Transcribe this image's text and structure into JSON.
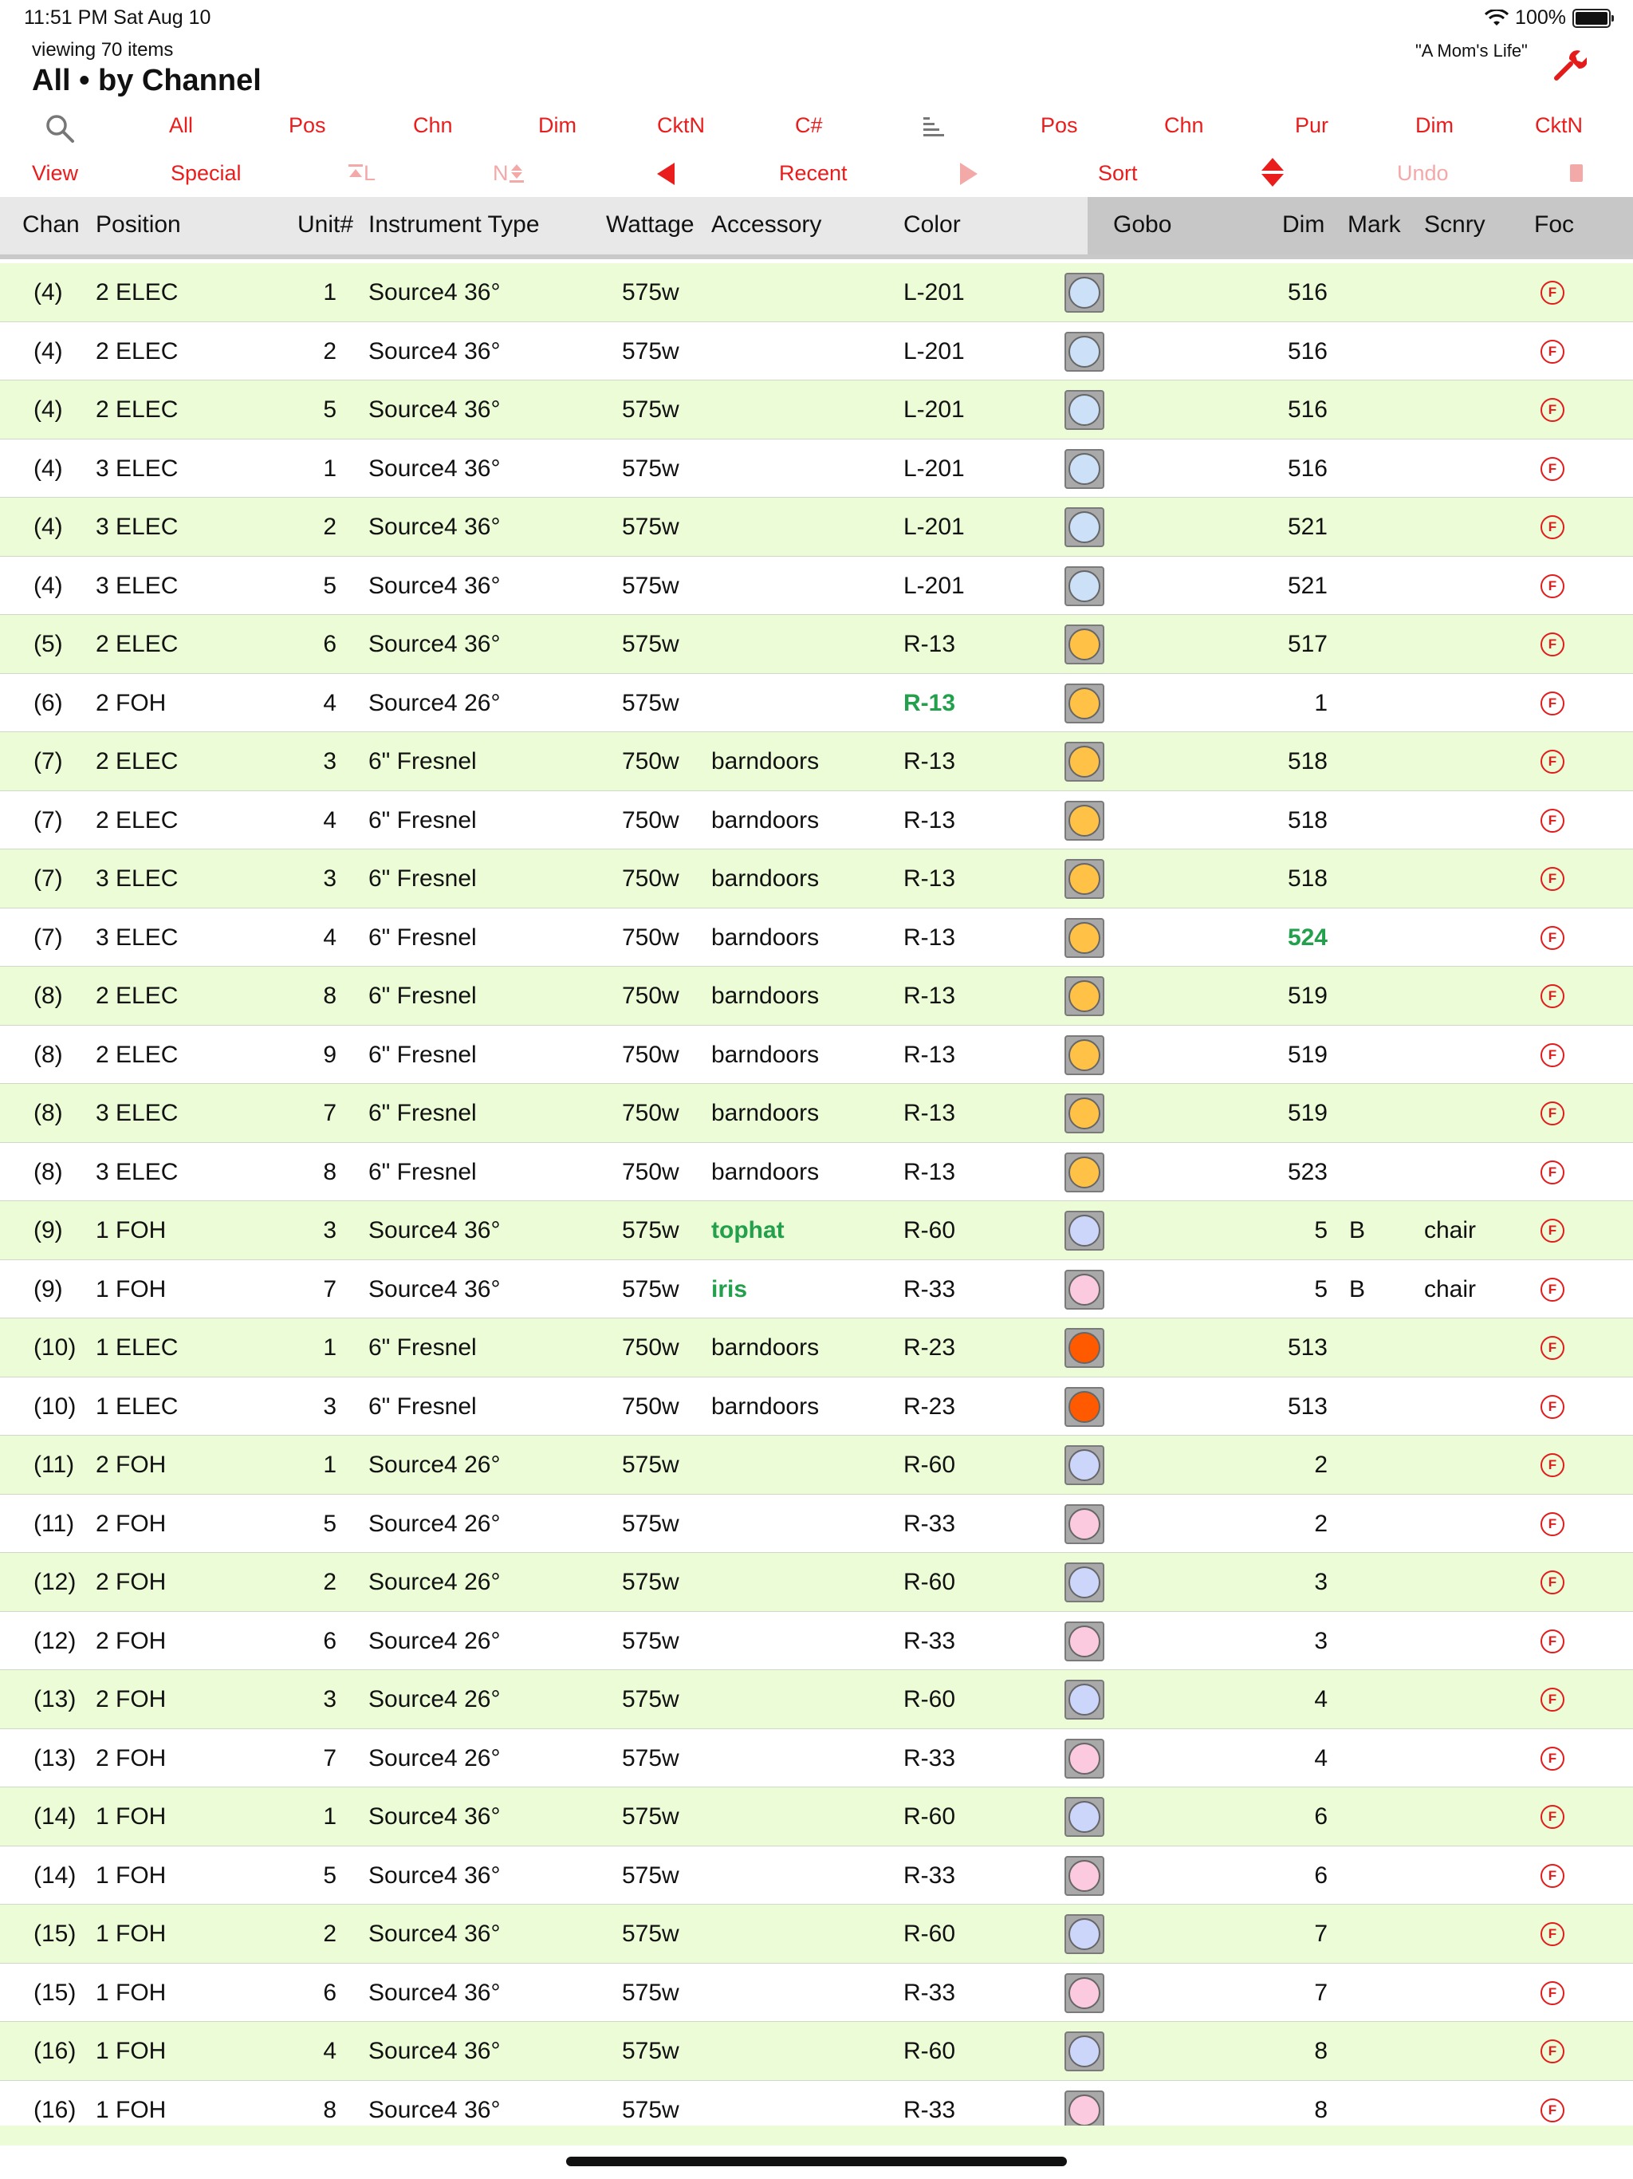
{
  "status": {
    "time": "11:51 PM   Sat Aug 10",
    "battery": "100%"
  },
  "header": {
    "viewing": "viewing 70 items",
    "title": "All • by Channel",
    "show_name": "\"A Mom's Life\""
  },
  "toolbar1": {
    "all": "All",
    "pos": "Pos",
    "chn": "Chn",
    "dim": "Dim",
    "cktn": "CktN",
    "cnum": "C#",
    "pos2": "Pos",
    "chn2": "Chn",
    "pur": "Pur",
    "dim2": "Dim",
    "cktn2": "CktN"
  },
  "toolbar2": {
    "view": "View",
    "special": "Special",
    "label_l": "L",
    "label_n": "N",
    "recent": "Recent",
    "sort": "Sort",
    "undo": "Undo"
  },
  "columns": {
    "chan": "Chan",
    "position": "Position",
    "unit": "Unit#",
    "itype": "Instrument Type",
    "wattage": "Wattage",
    "accessory": "Accessory",
    "color": "Color",
    "gobo": "Gobo",
    "dim": "Dim",
    "mark": "Mark",
    "scnry": "Scnry",
    "foc": "Foc"
  },
  "focus_glyph": "F",
  "swatch_colors": {
    "L-201": "#cce0f7",
    "R-13": "#ffc247",
    "R-60": "#ccd6fa",
    "R-33": "#fbcade",
    "R-23": "#ff5a00"
  },
  "rows": [
    {
      "chan": "(4)",
      "pos": "2 ELEC",
      "unit": "1",
      "itype": "Source4 36°",
      "watt": "575w",
      "acc": "",
      "color": "L-201",
      "dim": "516",
      "mark": "",
      "scnry": ""
    },
    {
      "chan": "(4)",
      "pos": "2 ELEC",
      "unit": "2",
      "itype": "Source4 36°",
      "watt": "575w",
      "acc": "",
      "color": "L-201",
      "dim": "516",
      "mark": "",
      "scnry": ""
    },
    {
      "chan": "(4)",
      "pos": "2 ELEC",
      "unit": "5",
      "itype": "Source4 36°",
      "watt": "575w",
      "acc": "",
      "color": "L-201",
      "dim": "516",
      "mark": "",
      "scnry": ""
    },
    {
      "chan": "(4)",
      "pos": "3 ELEC",
      "unit": "1",
      "itype": "Source4 36°",
      "watt": "575w",
      "acc": "",
      "color": "L-201",
      "dim": "516",
      "mark": "",
      "scnry": ""
    },
    {
      "chan": "(4)",
      "pos": "3 ELEC",
      "unit": "2",
      "itype": "Source4 36°",
      "watt": "575w",
      "acc": "",
      "color": "L-201",
      "dim": "521",
      "mark": "",
      "scnry": ""
    },
    {
      "chan": "(4)",
      "pos": "3 ELEC",
      "unit": "5",
      "itype": "Source4 36°",
      "watt": "575w",
      "acc": "",
      "color": "L-201",
      "dim": "521",
      "mark": "",
      "scnry": ""
    },
    {
      "chan": "(5)",
      "pos": "2 ELEC",
      "unit": "6",
      "itype": "Source4 36°",
      "watt": "575w",
      "acc": "",
      "color": "R-13",
      "dim": "517",
      "mark": "",
      "scnry": ""
    },
    {
      "chan": "(6)",
      "pos": "2 FOH",
      "unit": "4",
      "itype": "Source4 26°",
      "watt": "575w",
      "acc": "",
      "color": "R-13",
      "dim": "1",
      "mark": "",
      "scnry": "",
      "hl_color": true
    },
    {
      "chan": "(7)",
      "pos": "2 ELEC",
      "unit": "3",
      "itype": "6\" Fresnel",
      "watt": "750w",
      "acc": "barndoors",
      "color": "R-13",
      "dim": "518",
      "mark": "",
      "scnry": ""
    },
    {
      "chan": "(7)",
      "pos": "2 ELEC",
      "unit": "4",
      "itype": "6\" Fresnel",
      "watt": "750w",
      "acc": "barndoors",
      "color": "R-13",
      "dim": "518",
      "mark": "",
      "scnry": ""
    },
    {
      "chan": "(7)",
      "pos": "3 ELEC",
      "unit": "3",
      "itype": "6\" Fresnel",
      "watt": "750w",
      "acc": "barndoors",
      "color": "R-13",
      "dim": "518",
      "mark": "",
      "scnry": ""
    },
    {
      "chan": "(7)",
      "pos": "3 ELEC",
      "unit": "4",
      "itype": "6\" Fresnel",
      "watt": "750w",
      "acc": "barndoors",
      "color": "R-13",
      "dim": "524",
      "mark": "",
      "scnry": "",
      "hl_dim": true
    },
    {
      "chan": "(8)",
      "pos": "2 ELEC",
      "unit": "8",
      "itype": "6\" Fresnel",
      "watt": "750w",
      "acc": "barndoors",
      "color": "R-13",
      "dim": "519",
      "mark": "",
      "scnry": ""
    },
    {
      "chan": "(8)",
      "pos": "2 ELEC",
      "unit": "9",
      "itype": "6\" Fresnel",
      "watt": "750w",
      "acc": "barndoors",
      "color": "R-13",
      "dim": "519",
      "mark": "",
      "scnry": ""
    },
    {
      "chan": "(8)",
      "pos": "3 ELEC",
      "unit": "7",
      "itype": "6\" Fresnel",
      "watt": "750w",
      "acc": "barndoors",
      "color": "R-13",
      "dim": "519",
      "mark": "",
      "scnry": ""
    },
    {
      "chan": "(8)",
      "pos": "3 ELEC",
      "unit": "8",
      "itype": "6\" Fresnel",
      "watt": "750w",
      "acc": "barndoors",
      "color": "R-13",
      "dim": "523",
      "mark": "",
      "scnry": ""
    },
    {
      "chan": "(9)",
      "pos": "1 FOH",
      "unit": "3",
      "itype": "Source4 36°",
      "watt": "575w",
      "acc": "tophat",
      "color": "R-60",
      "dim": "5",
      "mark": "B",
      "scnry": "chair",
      "hl_acc": true
    },
    {
      "chan": "(9)",
      "pos": "1 FOH",
      "unit": "7",
      "itype": "Source4 36°",
      "watt": "575w",
      "acc": "iris",
      "color": "R-33",
      "dim": "5",
      "mark": "B",
      "scnry": "chair",
      "hl_acc": true
    },
    {
      "chan": "(10)",
      "pos": "1 ELEC",
      "unit": "1",
      "itype": "6\" Fresnel",
      "watt": "750w",
      "acc": "barndoors",
      "color": "R-23",
      "dim": "513",
      "mark": "",
      "scnry": ""
    },
    {
      "chan": "(10)",
      "pos": "1 ELEC",
      "unit": "3",
      "itype": "6\" Fresnel",
      "watt": "750w",
      "acc": "barndoors",
      "color": "R-23",
      "dim": "513",
      "mark": "",
      "scnry": ""
    },
    {
      "chan": "(11)",
      "pos": "2 FOH",
      "unit": "1",
      "itype": "Source4 26°",
      "watt": "575w",
      "acc": "",
      "color": "R-60",
      "dim": "2",
      "mark": "",
      "scnry": ""
    },
    {
      "chan": "(11)",
      "pos": "2 FOH",
      "unit": "5",
      "itype": "Source4 26°",
      "watt": "575w",
      "acc": "",
      "color": "R-33",
      "dim": "2",
      "mark": "",
      "scnry": ""
    },
    {
      "chan": "(12)",
      "pos": "2 FOH",
      "unit": "2",
      "itype": "Source4 26°",
      "watt": "575w",
      "acc": "",
      "color": "R-60",
      "dim": "3",
      "mark": "",
      "scnry": ""
    },
    {
      "chan": "(12)",
      "pos": "2 FOH",
      "unit": "6",
      "itype": "Source4 26°",
      "watt": "575w",
      "acc": "",
      "color": "R-33",
      "dim": "3",
      "mark": "",
      "scnry": ""
    },
    {
      "chan": "(13)",
      "pos": "2 FOH",
      "unit": "3",
      "itype": "Source4 26°",
      "watt": "575w",
      "acc": "",
      "color": "R-60",
      "dim": "4",
      "mark": "",
      "scnry": ""
    },
    {
      "chan": "(13)",
      "pos": "2 FOH",
      "unit": "7",
      "itype": "Source4 26°",
      "watt": "575w",
      "acc": "",
      "color": "R-33",
      "dim": "4",
      "mark": "",
      "scnry": ""
    },
    {
      "chan": "(14)",
      "pos": "1 FOH",
      "unit": "1",
      "itype": "Source4 36°",
      "watt": "575w",
      "acc": "",
      "color": "R-60",
      "dim": "6",
      "mark": "",
      "scnry": ""
    },
    {
      "chan": "(14)",
      "pos": "1 FOH",
      "unit": "5",
      "itype": "Source4 36°",
      "watt": "575w",
      "acc": "",
      "color": "R-33",
      "dim": "6",
      "mark": "",
      "scnry": ""
    },
    {
      "chan": "(15)",
      "pos": "1 FOH",
      "unit": "2",
      "itype": "Source4 36°",
      "watt": "575w",
      "acc": "",
      "color": "R-60",
      "dim": "7",
      "mark": "",
      "scnry": ""
    },
    {
      "chan": "(15)",
      "pos": "1 FOH",
      "unit": "6",
      "itype": "Source4 36°",
      "watt": "575w",
      "acc": "",
      "color": "R-33",
      "dim": "7",
      "mark": "",
      "scnry": ""
    },
    {
      "chan": "(16)",
      "pos": "1 FOH",
      "unit": "4",
      "itype": "Source4 36°",
      "watt": "575w",
      "acc": "",
      "color": "R-60",
      "dim": "8",
      "mark": "",
      "scnry": ""
    },
    {
      "chan": "(16)",
      "pos": "1 FOH",
      "unit": "8",
      "itype": "Source4 36°",
      "watt": "575w",
      "acc": "",
      "color": "R-33",
      "dim": "8",
      "mark": "",
      "scnry": ""
    }
  ]
}
